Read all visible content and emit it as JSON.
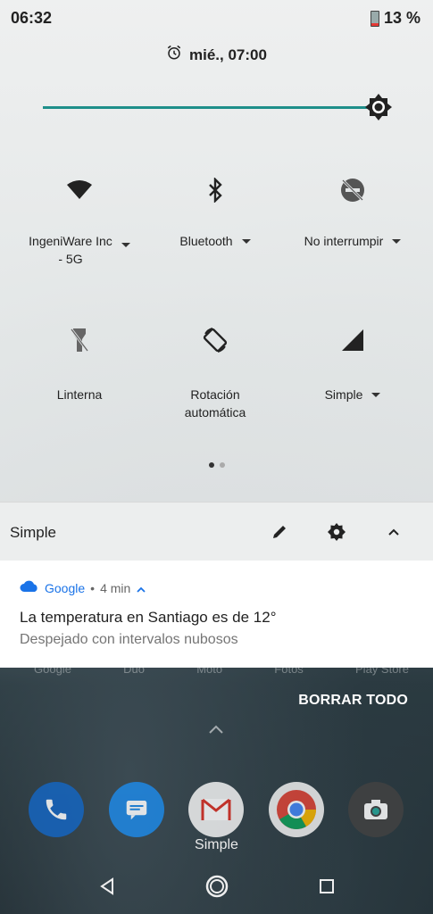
{
  "status_bar": {
    "time": "06:32",
    "battery": "13 %"
  },
  "alarm": {
    "text": "mié., 07:00",
    "icon": "alarm-clock-icon"
  },
  "brightness": {
    "level_percent": 95,
    "icon": "brightness-icon"
  },
  "quick_settings": {
    "tiles": [
      {
        "id": "wifi",
        "label_line1": "IngeniWare Inc",
        "label_line2": "- 5G",
        "icon": "wifi-icon",
        "has_dropdown": true
      },
      {
        "id": "bluetooth",
        "label_line1": "Bluetooth",
        "label_line2": "",
        "icon": "bluetooth-icon",
        "has_dropdown": true
      },
      {
        "id": "dnd",
        "label_line1": "No interrumpir",
        "label_line2": "",
        "icon": "do-not-disturb-off-icon",
        "has_dropdown": true
      },
      {
        "id": "flashlight",
        "label_line1": "Linterna",
        "label_line2": "",
        "icon": "flashlight-off-icon",
        "has_dropdown": false
      },
      {
        "id": "rotation",
        "label_line1": "Rotación",
        "label_line2": "automática",
        "icon": "auto-rotate-icon",
        "has_dropdown": false
      },
      {
        "id": "mobile-data",
        "label_line1": "Simple",
        "label_line2": "",
        "icon": "cell-signal-icon",
        "has_dropdown": true
      }
    ],
    "page_count": 2,
    "active_page": 1
  },
  "footer": {
    "carrier_label": "Simple"
  },
  "notification": {
    "app_name": "Google",
    "separator": "•",
    "time_ago": "4 min",
    "title": "La temperatura en Santiago es de 12°",
    "body": "Despejado con intervalos nubosos"
  },
  "clear_all_label": "BORRAR TODO",
  "home_behind": {
    "faded_labels": [
      "Google",
      "Duo",
      "Moto",
      "Fotos",
      "Play Store"
    ],
    "dock_label": "Simple",
    "dock_apps": [
      "phone-icon",
      "messages-icon",
      "gmail-icon",
      "chrome-icon",
      "camera-icon"
    ]
  },
  "colors": {
    "accent": "#1e8f8a",
    "google_blue": "#1a73e8"
  }
}
